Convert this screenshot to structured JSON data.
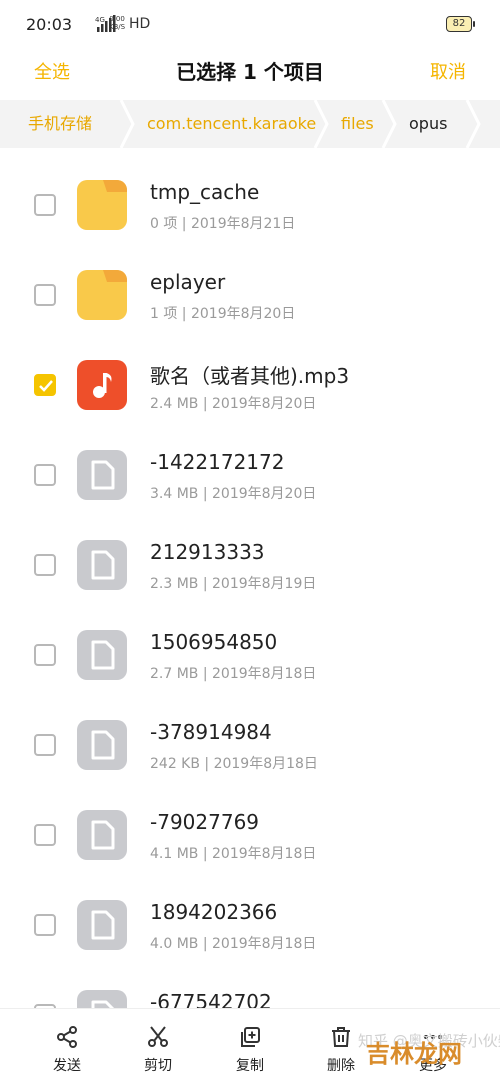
{
  "status_bar": {
    "time": "20:03",
    "network_speed_line1": "0.00",
    "network_speed_line2": "KB/S",
    "network_type": "4G",
    "hd": "HD",
    "battery": "82"
  },
  "header": {
    "select_all": "全选",
    "title": "已选择 1 个项目",
    "cancel": "取消"
  },
  "breadcrumb": {
    "items": [
      "手机存储",
      "com.tencent.karaoke",
      "files",
      "opus"
    ]
  },
  "files": [
    {
      "name": "tmp_cache",
      "meta": "0 项 | 2019年8月21日",
      "type": "folder",
      "checked": false
    },
    {
      "name": "eplayer",
      "meta": "1 项 | 2019年8月20日",
      "type": "folder",
      "checked": false
    },
    {
      "name": "歌名（或者其他).mp3",
      "meta": "2.4 MB | 2019年8月20日",
      "type": "audio",
      "checked": true
    },
    {
      "name": "-1422172172",
      "meta": "3.4 MB | 2019年8月20日",
      "type": "file",
      "checked": false
    },
    {
      "name": "212913333",
      "meta": "2.3 MB | 2019年8月19日",
      "type": "file",
      "checked": false
    },
    {
      "name": "1506954850",
      "meta": "2.7 MB | 2019年8月18日",
      "type": "file",
      "checked": false
    },
    {
      "name": "-378914984",
      "meta": "242 KB | 2019年8月18日",
      "type": "file",
      "checked": false
    },
    {
      "name": "-79027769",
      "meta": "4.1 MB | 2019年8月18日",
      "type": "file",
      "checked": false
    },
    {
      "name": "1894202366",
      "meta": "4.0 MB | 2019年8月18日",
      "type": "file",
      "checked": false
    },
    {
      "name": "-677542702",
      "meta": "",
      "type": "file",
      "checked": false
    }
  ],
  "toolbar": {
    "send": "发送",
    "cut": "剪切",
    "copy": "复制",
    "delete": "删除",
    "more": "更多"
  },
  "watermark": {
    "text": "知乎 @奥文搬砖小伙柴",
    "site_logo": "吉林龙网"
  },
  "colors": {
    "accent": "#f5b500",
    "folder": "#f9c94a",
    "audio_icon": "#ee4f2a",
    "file_icon": "#c9cace",
    "checkbox_checked": "#f5c400"
  }
}
